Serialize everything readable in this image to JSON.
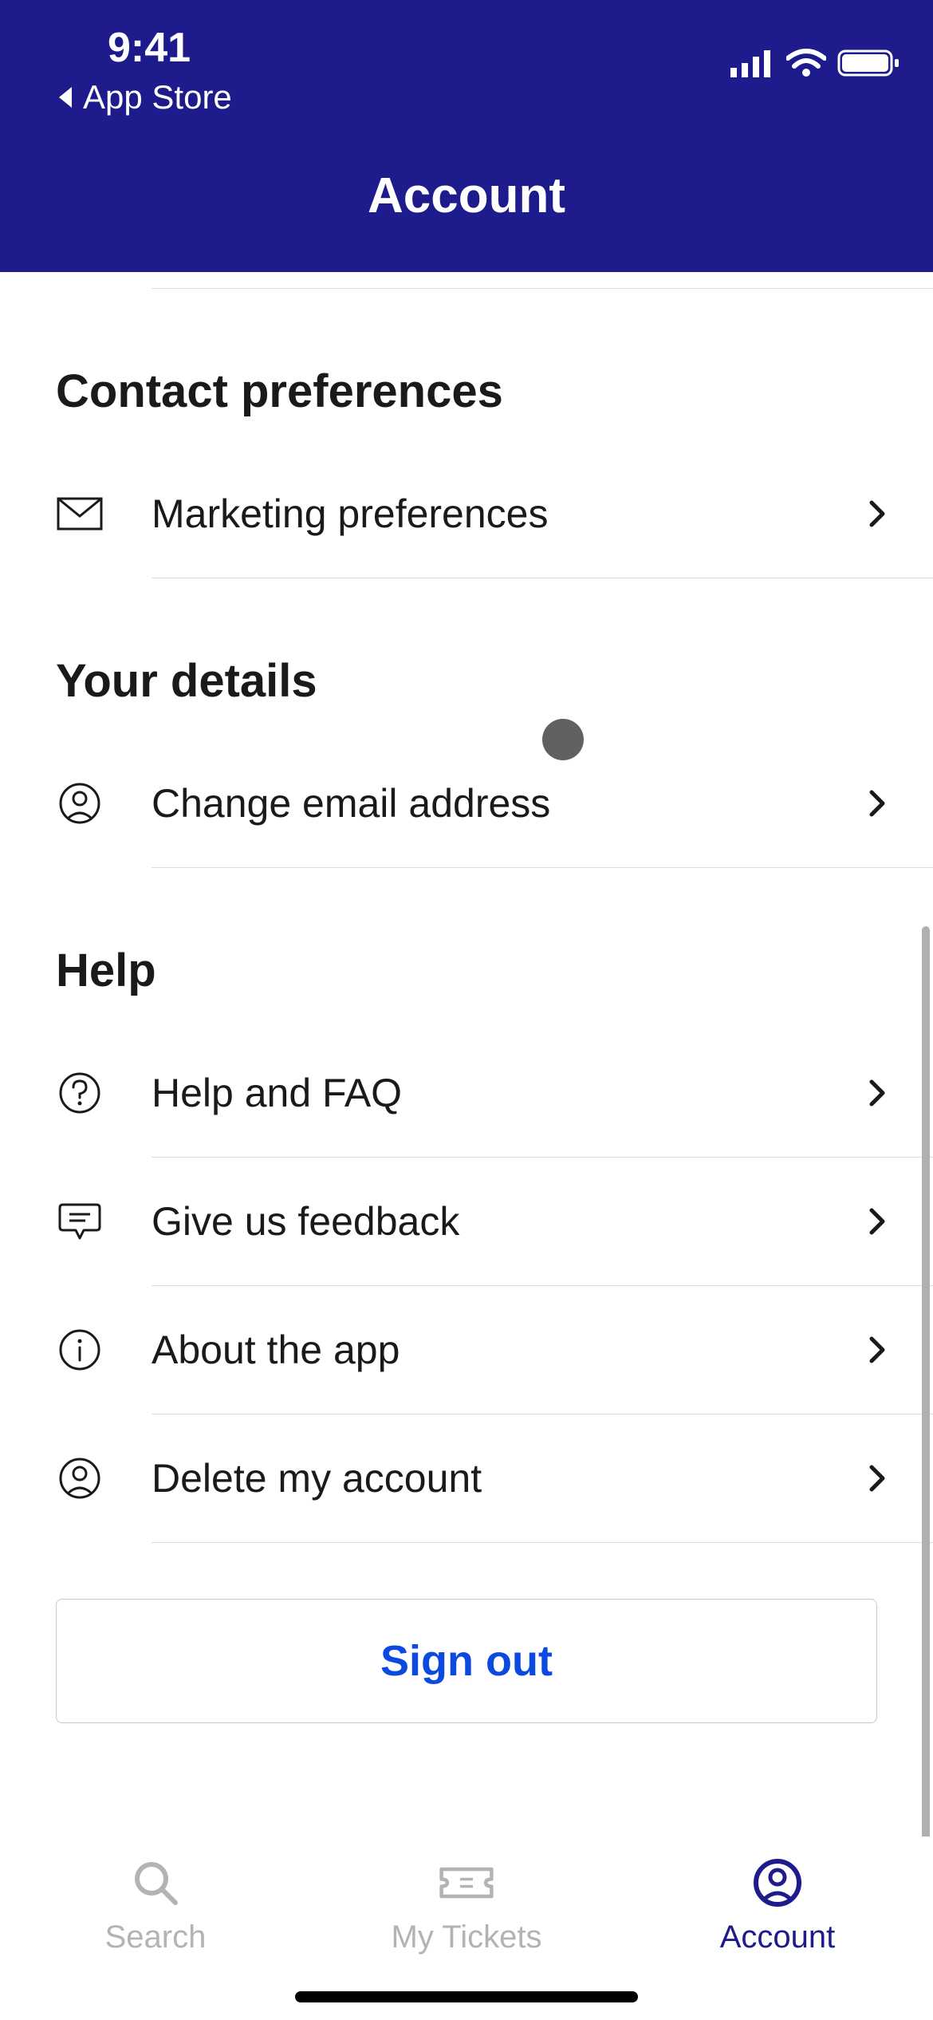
{
  "status": {
    "time": "9:41",
    "back_label": "App Store"
  },
  "nav": {
    "title": "Account"
  },
  "sections": [
    {
      "title": "Contact preferences",
      "items": [
        {
          "icon": "envelope",
          "label": "Marketing preferences"
        }
      ]
    },
    {
      "title": "Your details",
      "items": [
        {
          "icon": "person-circle",
          "label": "Change email address"
        }
      ]
    },
    {
      "title": "Help",
      "items": [
        {
          "icon": "question-circle",
          "label": "Help and FAQ"
        },
        {
          "icon": "chat-bubble",
          "label": "Give us feedback"
        },
        {
          "icon": "info-circle",
          "label": "About the app"
        },
        {
          "icon": "person-circle",
          "label": "Delete my account"
        }
      ]
    }
  ],
  "signout_label": "Sign out",
  "tabs": [
    {
      "icon": "search",
      "label": "Search",
      "active": false
    },
    {
      "icon": "ticket",
      "label": "My Tickets",
      "active": false
    },
    {
      "icon": "person-circle",
      "label": "Account",
      "active": true
    }
  ]
}
